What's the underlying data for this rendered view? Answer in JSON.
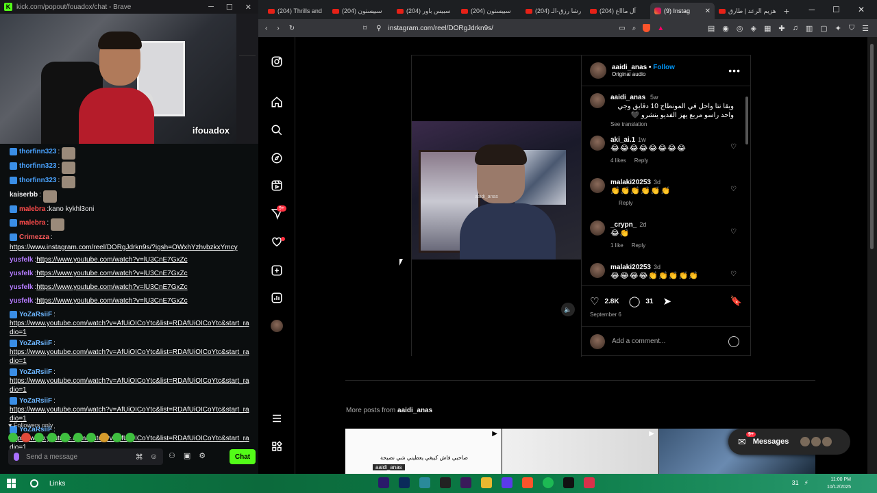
{
  "kick": {
    "window_title": "kick.com/popout/fouadox/chat - Brave",
    "stream_caption": "ifouadox",
    "messages": [
      {
        "user": "thorfinn323",
        "color": "#4aa3ff",
        "badge": true,
        "text": "",
        "emote": true
      },
      {
        "user": "thorfinn323",
        "color": "#4aa3ff",
        "badge": true,
        "text": "",
        "emote": true
      },
      {
        "user": "thorfinn323",
        "color": "#4aa3ff",
        "badge": true,
        "text": "",
        "emote": true
      },
      {
        "user": "kaiserbb",
        "color": "#efeff1",
        "badge": false,
        "text": "",
        "emote": true
      },
      {
        "user": "malebra",
        "color": "#ff4b4b",
        "badge": true,
        "text": "kano kykhl3oni",
        "emote": false
      },
      {
        "user": "malebra",
        "color": "#ff4b4b",
        "badge": true,
        "text": "",
        "emote": true
      },
      {
        "user": "Crimezza",
        "color": "#ff5b5b",
        "badge": true,
        "text": "https://www.instagram.com/reel/DORgJdrkn9s/?igsh=OWxhYzhvbzkxYmcy",
        "emote": false,
        "link": true
      },
      {
        "user": "yusfelk",
        "color": "#b57bff",
        "badge": false,
        "text": "https://www.youtube.com/watch?v=lU3CnE7GxZc",
        "emote": false,
        "link": true
      },
      {
        "user": "yusfelk",
        "color": "#b57bff",
        "badge": false,
        "text": "https://www.youtube.com/watch?v=lU3CnE7GxZc",
        "emote": false,
        "link": true
      },
      {
        "user": "yusfelk",
        "color": "#b57bff",
        "badge": false,
        "text": "https://www.youtube.com/watch?v=lU3CnE7GxZc",
        "emote": false,
        "link": true
      },
      {
        "user": "yusfelk",
        "color": "#b57bff",
        "badge": false,
        "text": "https://www.youtube.com/watch?v=lU3CnE7GxZc",
        "emote": false,
        "link": true
      },
      {
        "user": "YoZaRsiiF",
        "color": "#6db6ff",
        "badge": true,
        "text": "https://www.youtube.com/watch?v=AfUiOICoYtc&list=RDAfUiOICoYtc&start_radio=1",
        "emote": false,
        "link": true
      },
      {
        "user": "YoZaRsiiF",
        "color": "#6db6ff",
        "badge": true,
        "text": "https://www.youtube.com/watch?v=AfUiOICoYtc&list=RDAfUiOICoYtc&start_radio=1",
        "emote": false,
        "link": true
      },
      {
        "user": "YoZaRsiiF",
        "color": "#6db6ff",
        "badge": true,
        "text": "https://www.youtube.com/watch?v=AfUiOICoYtc&list=RDAfUiOICoYtc&start_radio=1",
        "emote": false,
        "link": true
      },
      {
        "user": "YoZaRsiiF",
        "color": "#6db6ff",
        "badge": true,
        "text": "https://www.youtube.com/watch?v=AfUiOICoYtc&list=RDAfUiOICoYtc&start_radio=1",
        "emote": false,
        "link": true
      },
      {
        "user": "YoZaRsiiF",
        "color": "#6db6ff",
        "badge": true,
        "text": "https://www.youtube.com/watch?v=AfUiOICoYtc&list=RDAfUiOICoYtc&start_radio=1",
        "emote": false,
        "link": true
      }
    ],
    "followers_only": "Followers only",
    "input_placeholder": "Send a message",
    "chat_button": "Chat",
    "accent": "#53fc18"
  },
  "browser": {
    "tabs": [
      {
        "label": "(204) Thrills and",
        "icon": "youtube-icon"
      },
      {
        "label": "(204) سبيستون",
        "icon": "youtube-icon"
      },
      {
        "label": "(204) سبيس باور",
        "icon": "youtube-icon"
      },
      {
        "label": "(204) سبيستون",
        "icon": "youtube-icon"
      },
      {
        "label": "(204) رشا رزق-الـ",
        "icon": "youtube-icon"
      },
      {
        "label": "(204) آل ماااع",
        "icon": "youtube-icon"
      },
      {
        "label": "(9) Instag",
        "icon": "instagram-icon",
        "active": true
      },
      {
        "label": "هزيم الرعد | طارق",
        "icon": "youtube-icon"
      }
    ],
    "url": "instagram.com/reel/DORgJdrkn9s/"
  },
  "instagram": {
    "notif_count": "9+",
    "post_author": "aaidi_anas",
    "follow_label": "Follow",
    "audio": "Original audio",
    "caption_user": "aaidi_anas",
    "caption_time": "5w",
    "caption_text": "وبقا نتا واحل في المونطاج 10 دقايق وجي واحد راسو مربع يهز الفديو ينشرو 🖤",
    "see_translation": "See translation",
    "video_watermark": "aaidi_anas",
    "comments": [
      {
        "user": "aki_ai.1",
        "time": "1w",
        "text": "😂😂😂😂😂😂😂😂",
        "likes": "4 likes",
        "reply": "Reply"
      },
      {
        "user": "malaki20253",
        "time": "3d",
        "text": "👏👏👏👏👏👏",
        "likes": "",
        "reply": "Reply"
      },
      {
        "user": "_crypn_",
        "time": "2d",
        "text": "😂👏",
        "likes": "1 like",
        "reply": "Reply"
      },
      {
        "user": "malaki20253",
        "time": "3d",
        "text": "😂😂😂😂👏👏👏👏👏",
        "likes": "",
        "reply": ""
      }
    ],
    "like_count": "2.8K",
    "comment_count": "31",
    "date": "September 6",
    "add_comment": "Add a comment...",
    "more_posts_prefix": "More posts from",
    "more_posts_user": "aaidi_anas",
    "thumb1_caption": "صاحبي فاش كيبغي يعطيني شي نصيحة",
    "thumb1_watermark": "aaidi_anas",
    "messages_label": "Messages",
    "messages_count": "9+"
  },
  "taskbar": {
    "search_label": "Links",
    "time": "11:00 PM",
    "date": "10/12/2025",
    "battery": "31"
  }
}
